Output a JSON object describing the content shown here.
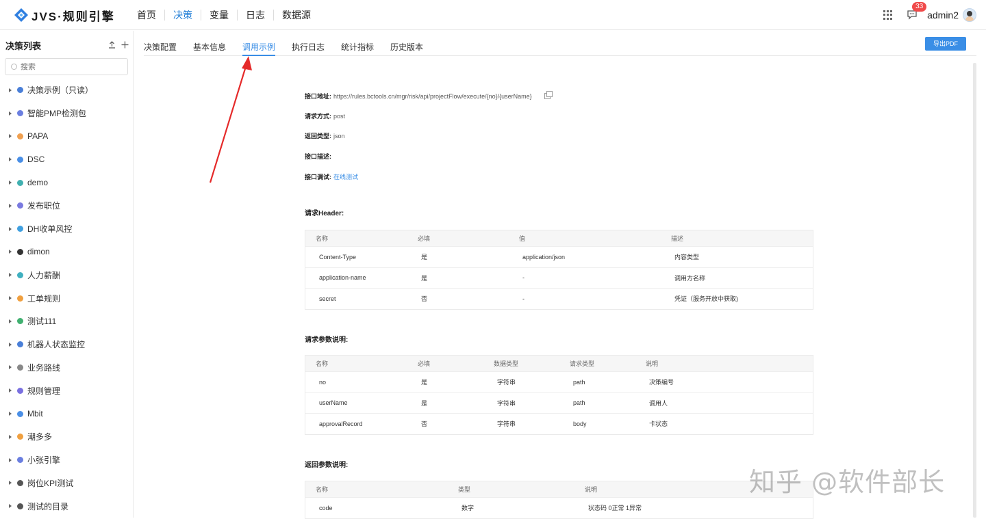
{
  "app": {
    "logo_text": "JVS·规则引擎",
    "nav": [
      "首页",
      "决策",
      "变量",
      "日志",
      "数据源"
    ],
    "nav_active_index": 1,
    "message_count": "33",
    "username": "admin2",
    "accent_color": "#3a8ee6"
  },
  "sidebar": {
    "title": "决策列表",
    "search_placeholder": "搜索",
    "items": [
      {
        "label": "决策示例（只读）",
        "color": "#4a7fd8"
      },
      {
        "label": "智能PMP检测包",
        "color": "#6b7fe0"
      },
      {
        "label": "PAPA",
        "color": "#f0a050"
      },
      {
        "label": "DSC",
        "color": "#4a8fe6"
      },
      {
        "label": "demo",
        "color": "#40b0b0"
      },
      {
        "label": "发布职位",
        "color": "#7a7ae0"
      },
      {
        "label": "DH收单风控",
        "color": "#40a0e0"
      },
      {
        "label": "dimon",
        "color": "#333333"
      },
      {
        "label": "人力薪酬",
        "color": "#40b0c0"
      },
      {
        "label": "工单规则",
        "color": "#f0a040"
      },
      {
        "label": "测试111",
        "color": "#40b070"
      },
      {
        "label": "机器人状态监控",
        "color": "#4a7fd8"
      },
      {
        "label": "业务路线",
        "color": "#888888"
      },
      {
        "label": "规则管理",
        "color": "#7a70e0"
      },
      {
        "label": "Mbit",
        "color": "#4a8fe6"
      },
      {
        "label": "潮多多",
        "color": "#f0a040"
      },
      {
        "label": "小张引擎",
        "color": "#6b7fe0"
      },
      {
        "label": "岗位KPI测试",
        "color": "#555555"
      },
      {
        "label": "测试的目录",
        "color": "#555555"
      }
    ]
  },
  "tabs": [
    "决策配置",
    "基本信息",
    "调用示例",
    "执行日志",
    "统计指标",
    "历史版本"
  ],
  "active_tab_index": 2,
  "export_label": "导出PDF",
  "api": {
    "url_key": "接口地址:",
    "url": "https://rules.bctools.cn/mgr/risk/api/projectFlow/execute/{no}/{userName}",
    "method_key": "请求方式:",
    "method": "post",
    "return_key": "返回类型:",
    "return_type": "json",
    "desc_key": "接口描述:",
    "desc": "",
    "debug_key": "接口调试:",
    "debug_link": "在线测试"
  },
  "header_section": {
    "title": "请求Header:",
    "columns": [
      "名称",
      "必填",
      "值",
      "描述"
    ],
    "rows": [
      [
        "Content-Type",
        "是",
        "application/json",
        "内容类型"
      ],
      [
        "application-name",
        "是",
        "-",
        "调用方名称"
      ],
      [
        "secret",
        "否",
        "-",
        "凭证（服务开放中获取)"
      ]
    ]
  },
  "params_section": {
    "title": "请求参数说明:",
    "columns": [
      "名称",
      "必填",
      "数据类型",
      "请求类型",
      "说明"
    ],
    "rows": [
      [
        "no",
        "是",
        "字符串",
        "path",
        "决策编号"
      ],
      [
        "userName",
        "是",
        "字符串",
        "path",
        "调用人"
      ],
      [
        "approvalRecord",
        "否",
        "字符串",
        "body",
        "卡状态"
      ]
    ]
  },
  "return_section": {
    "title": "返回参数说明:",
    "columns": [
      "名称",
      "类型",
      "说明"
    ],
    "rows": [
      [
        "code",
        "数字",
        "状态码 0正常 1异常"
      ]
    ]
  },
  "watermark": "知乎 @软件部长"
}
